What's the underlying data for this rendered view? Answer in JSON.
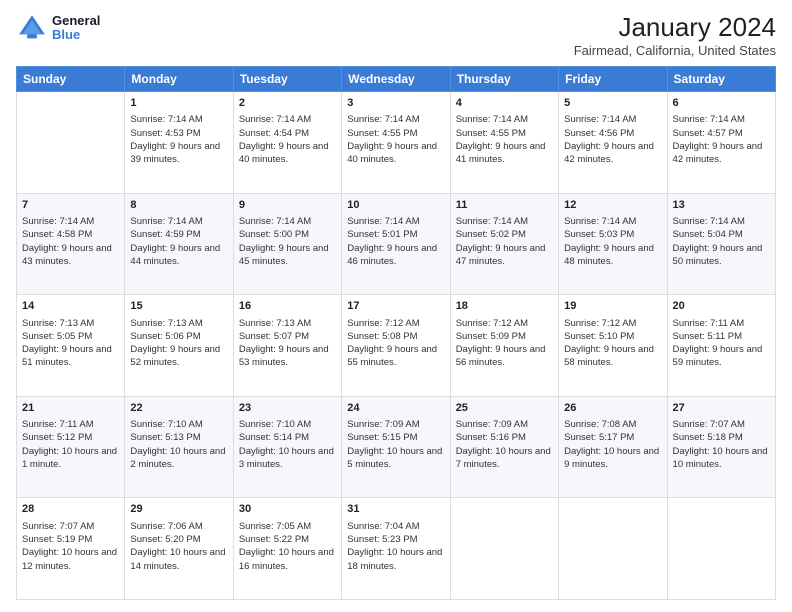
{
  "header": {
    "logo_line1": "General",
    "logo_line2": "Blue",
    "month_title": "January 2024",
    "location": "Fairmead, California, United States"
  },
  "days_of_week": [
    "Sunday",
    "Monday",
    "Tuesday",
    "Wednesday",
    "Thursday",
    "Friday",
    "Saturday"
  ],
  "weeks": [
    [
      {
        "day": "",
        "sunrise": "",
        "sunset": "",
        "daylight": ""
      },
      {
        "day": "1",
        "sunrise": "Sunrise: 7:14 AM",
        "sunset": "Sunset: 4:53 PM",
        "daylight": "Daylight: 9 hours and 39 minutes."
      },
      {
        "day": "2",
        "sunrise": "Sunrise: 7:14 AM",
        "sunset": "Sunset: 4:54 PM",
        "daylight": "Daylight: 9 hours and 40 minutes."
      },
      {
        "day": "3",
        "sunrise": "Sunrise: 7:14 AM",
        "sunset": "Sunset: 4:55 PM",
        "daylight": "Daylight: 9 hours and 40 minutes."
      },
      {
        "day": "4",
        "sunrise": "Sunrise: 7:14 AM",
        "sunset": "Sunset: 4:55 PM",
        "daylight": "Daylight: 9 hours and 41 minutes."
      },
      {
        "day": "5",
        "sunrise": "Sunrise: 7:14 AM",
        "sunset": "Sunset: 4:56 PM",
        "daylight": "Daylight: 9 hours and 42 minutes."
      },
      {
        "day": "6",
        "sunrise": "Sunrise: 7:14 AM",
        "sunset": "Sunset: 4:57 PM",
        "daylight": "Daylight: 9 hours and 42 minutes."
      }
    ],
    [
      {
        "day": "7",
        "sunrise": "Sunrise: 7:14 AM",
        "sunset": "Sunset: 4:58 PM",
        "daylight": "Daylight: 9 hours and 43 minutes."
      },
      {
        "day": "8",
        "sunrise": "Sunrise: 7:14 AM",
        "sunset": "Sunset: 4:59 PM",
        "daylight": "Daylight: 9 hours and 44 minutes."
      },
      {
        "day": "9",
        "sunrise": "Sunrise: 7:14 AM",
        "sunset": "Sunset: 5:00 PM",
        "daylight": "Daylight: 9 hours and 45 minutes."
      },
      {
        "day": "10",
        "sunrise": "Sunrise: 7:14 AM",
        "sunset": "Sunset: 5:01 PM",
        "daylight": "Daylight: 9 hours and 46 minutes."
      },
      {
        "day": "11",
        "sunrise": "Sunrise: 7:14 AM",
        "sunset": "Sunset: 5:02 PM",
        "daylight": "Daylight: 9 hours and 47 minutes."
      },
      {
        "day": "12",
        "sunrise": "Sunrise: 7:14 AM",
        "sunset": "Sunset: 5:03 PM",
        "daylight": "Daylight: 9 hours and 48 minutes."
      },
      {
        "day": "13",
        "sunrise": "Sunrise: 7:14 AM",
        "sunset": "Sunset: 5:04 PM",
        "daylight": "Daylight: 9 hours and 50 minutes."
      }
    ],
    [
      {
        "day": "14",
        "sunrise": "Sunrise: 7:13 AM",
        "sunset": "Sunset: 5:05 PM",
        "daylight": "Daylight: 9 hours and 51 minutes."
      },
      {
        "day": "15",
        "sunrise": "Sunrise: 7:13 AM",
        "sunset": "Sunset: 5:06 PM",
        "daylight": "Daylight: 9 hours and 52 minutes."
      },
      {
        "day": "16",
        "sunrise": "Sunrise: 7:13 AM",
        "sunset": "Sunset: 5:07 PM",
        "daylight": "Daylight: 9 hours and 53 minutes."
      },
      {
        "day": "17",
        "sunrise": "Sunrise: 7:12 AM",
        "sunset": "Sunset: 5:08 PM",
        "daylight": "Daylight: 9 hours and 55 minutes."
      },
      {
        "day": "18",
        "sunrise": "Sunrise: 7:12 AM",
        "sunset": "Sunset: 5:09 PM",
        "daylight": "Daylight: 9 hours and 56 minutes."
      },
      {
        "day": "19",
        "sunrise": "Sunrise: 7:12 AM",
        "sunset": "Sunset: 5:10 PM",
        "daylight": "Daylight: 9 hours and 58 minutes."
      },
      {
        "day": "20",
        "sunrise": "Sunrise: 7:11 AM",
        "sunset": "Sunset: 5:11 PM",
        "daylight": "Daylight: 9 hours and 59 minutes."
      }
    ],
    [
      {
        "day": "21",
        "sunrise": "Sunrise: 7:11 AM",
        "sunset": "Sunset: 5:12 PM",
        "daylight": "Daylight: 10 hours and 1 minute."
      },
      {
        "day": "22",
        "sunrise": "Sunrise: 7:10 AM",
        "sunset": "Sunset: 5:13 PM",
        "daylight": "Daylight: 10 hours and 2 minutes."
      },
      {
        "day": "23",
        "sunrise": "Sunrise: 7:10 AM",
        "sunset": "Sunset: 5:14 PM",
        "daylight": "Daylight: 10 hours and 3 minutes."
      },
      {
        "day": "24",
        "sunrise": "Sunrise: 7:09 AM",
        "sunset": "Sunset: 5:15 PM",
        "daylight": "Daylight: 10 hours and 5 minutes."
      },
      {
        "day": "25",
        "sunrise": "Sunrise: 7:09 AM",
        "sunset": "Sunset: 5:16 PM",
        "daylight": "Daylight: 10 hours and 7 minutes."
      },
      {
        "day": "26",
        "sunrise": "Sunrise: 7:08 AM",
        "sunset": "Sunset: 5:17 PM",
        "daylight": "Daylight: 10 hours and 9 minutes."
      },
      {
        "day": "27",
        "sunrise": "Sunrise: 7:07 AM",
        "sunset": "Sunset: 5:18 PM",
        "daylight": "Daylight: 10 hours and 10 minutes."
      }
    ],
    [
      {
        "day": "28",
        "sunrise": "Sunrise: 7:07 AM",
        "sunset": "Sunset: 5:19 PM",
        "daylight": "Daylight: 10 hours and 12 minutes."
      },
      {
        "day": "29",
        "sunrise": "Sunrise: 7:06 AM",
        "sunset": "Sunset: 5:20 PM",
        "daylight": "Daylight: 10 hours and 14 minutes."
      },
      {
        "day": "30",
        "sunrise": "Sunrise: 7:05 AM",
        "sunset": "Sunset: 5:22 PM",
        "daylight": "Daylight: 10 hours and 16 minutes."
      },
      {
        "day": "31",
        "sunrise": "Sunrise: 7:04 AM",
        "sunset": "Sunset: 5:23 PM",
        "daylight": "Daylight: 10 hours and 18 minutes."
      },
      {
        "day": "",
        "sunrise": "",
        "sunset": "",
        "daylight": ""
      },
      {
        "day": "",
        "sunrise": "",
        "sunset": "",
        "daylight": ""
      },
      {
        "day": "",
        "sunrise": "",
        "sunset": "",
        "daylight": ""
      }
    ]
  ]
}
